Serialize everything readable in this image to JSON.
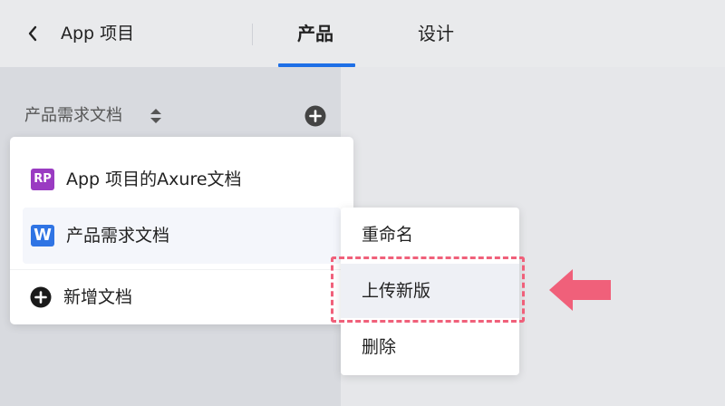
{
  "header": {
    "project_title": "App 项目",
    "tabs": [
      {
        "label": "产品",
        "active": true
      },
      {
        "label": "设计",
        "active": false
      }
    ],
    "accent_color": "#1e6fe6"
  },
  "sidebar": {
    "doc_selector_label": "产品需求文档",
    "doc_menu": {
      "items": [
        {
          "badge": "RP",
          "badge_color": "#9a3bc2",
          "label": "App 项目的Axure文档"
        },
        {
          "badge": "W",
          "badge_color": "#2f74e4",
          "label": "产品需求文档",
          "selected": true
        }
      ],
      "new_doc_label": "新增文档"
    }
  },
  "context_menu": {
    "items": [
      {
        "label": "重命名"
      },
      {
        "label": "上传新版",
        "highlighted": true
      },
      {
        "label": "删除"
      }
    ]
  },
  "annotation": {
    "highlight_color": "#f0607a",
    "arrow_color": "#f0607a"
  },
  "icons": [
    "back-chevron-icon",
    "sort-updown-icon",
    "plus-circle-icon",
    "arrow-left-icon"
  ]
}
